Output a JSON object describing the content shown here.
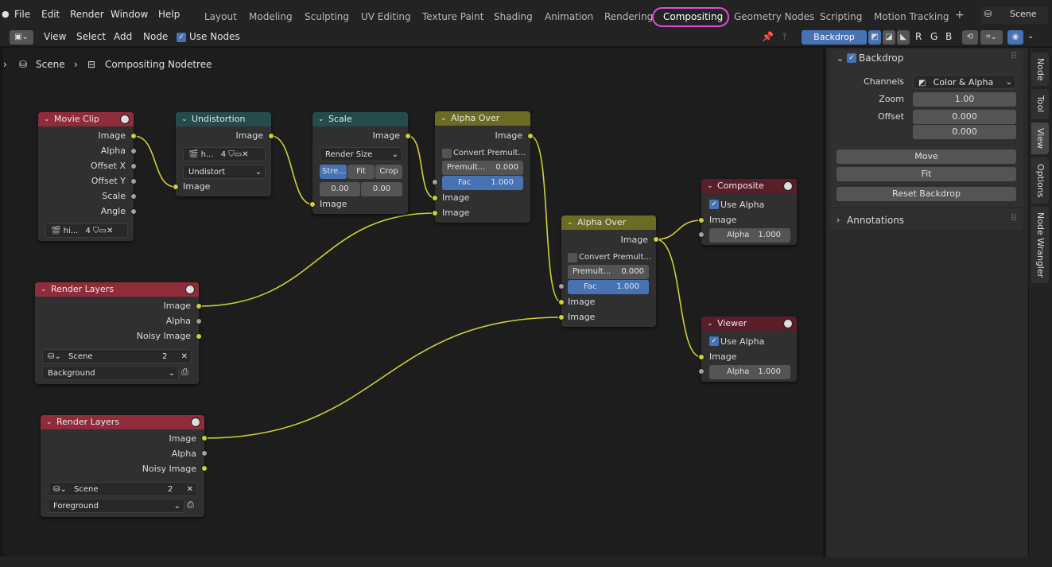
{
  "menu": [
    "File",
    "Edit",
    "Render",
    "Window",
    "Help"
  ],
  "workspaces": [
    "Layout",
    "Modeling",
    "Sculpting",
    "UV Editing",
    "Texture Paint",
    "Shading",
    "Animation",
    "Rendering",
    "Compositing",
    "Geometry Nodes",
    "Scripting",
    "Motion Tracking"
  ],
  "active_workspace": "Compositing",
  "scene_name": "Scene",
  "header": {
    "view": "View",
    "select": "Select",
    "add": "Add",
    "node": "Node",
    "use_nodes": "Use Nodes",
    "backdrop_btn": "Backdrop",
    "channels": [
      "R",
      "G",
      "B"
    ]
  },
  "breadcrumb": {
    "scene": "Scene",
    "tree": "Compositing Nodetree"
  },
  "nodes": {
    "movie_clip": {
      "title": "Movie Clip",
      "outputs": [
        "Image",
        "Alpha",
        "Offset X",
        "Offset Y",
        "Scale",
        "Angle"
      ],
      "clip": "hi...",
      "users": "4"
    },
    "undistortion": {
      "title": "Undistortion",
      "out": "Image",
      "in": "Image",
      "clip": "h...",
      "users": "4",
      "mode": "Undistort"
    },
    "scale": {
      "title": "Scale",
      "out": "Image",
      "in": "Image",
      "space": "Render Size",
      "fit": [
        "Stre...",
        "Fit",
        "Crop"
      ],
      "offx": "0.00",
      "offy": "0.00"
    },
    "alpha_over1": {
      "title": "Alpha Over",
      "out": "Image",
      "convert": "Convert Premult...",
      "premult_label": "Premult...",
      "premult": "0.000",
      "fac_label": "Fac",
      "fac": "1.000",
      "in1": "Image",
      "in2": "Image"
    },
    "alpha_over2": {
      "title": "Alpha Over",
      "out": "Image",
      "convert": "Convert Premult...",
      "premult_label": "Premult...",
      "premult": "0.000",
      "fac_label": "Fac",
      "fac": "1.000",
      "in1": "Image",
      "in2": "Image"
    },
    "render1": {
      "title": "Render Layers",
      "outputs": [
        "Image",
        "Alpha",
        "Noisy Image"
      ],
      "scene": "Scene",
      "users": "2",
      "layer": "Background"
    },
    "render2": {
      "title": "Render Layers",
      "outputs": [
        "Image",
        "Alpha",
        "Noisy Image"
      ],
      "scene": "Scene",
      "users": "2",
      "layer": "Foreground"
    },
    "composite": {
      "title": "Composite",
      "use_alpha": "Use Alpha",
      "in": "Image",
      "alpha_label": "Alpha",
      "alpha": "1.000"
    },
    "viewer": {
      "title": "Viewer",
      "use_alpha": "Use Alpha",
      "in": "Image",
      "alpha_label": "Alpha",
      "alpha": "1.000"
    }
  },
  "sidebar": {
    "backdrop": "Backdrop",
    "channels_label": "Channels",
    "channels_value": "Color & Alpha",
    "zoom_label": "Zoom",
    "zoom": "1.00",
    "offset_label": "Offset",
    "offset_x": "0.000",
    "offset_y": "0.000",
    "move": "Move",
    "fit": "Fit",
    "reset": "Reset Backdrop",
    "annotations": "Annotations"
  },
  "tabs": [
    "Node",
    "Tool",
    "View",
    "Options",
    "Node Wrangler"
  ],
  "active_tab": "View",
  "colors": {
    "accent": "#4772b3",
    "highlight": "#e24bd6",
    "wire": "#cfcf3a"
  }
}
